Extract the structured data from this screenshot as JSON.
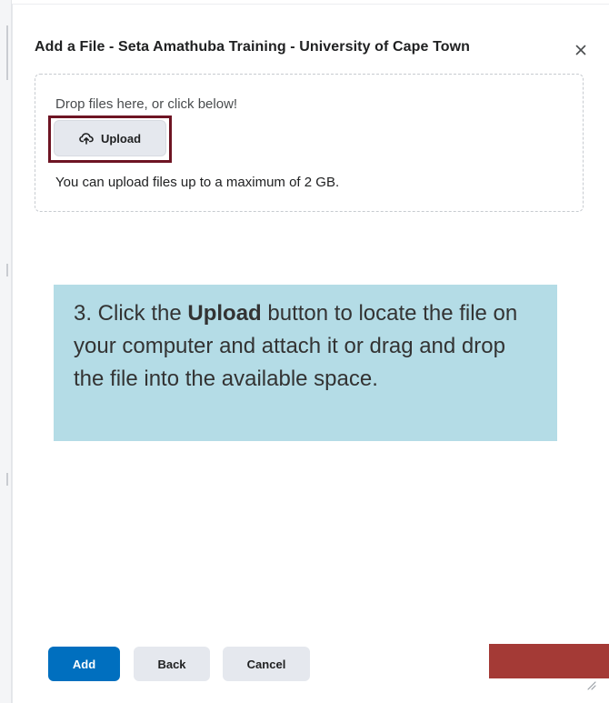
{
  "dialog": {
    "title": "Add a File - Seta Amathuba Training - University of Cape Town",
    "close_symbol": "×"
  },
  "dropzone": {
    "drop_text": "Drop files here, or click below!",
    "upload_label": "Upload",
    "upload_icon": "cloud-upload-icon",
    "limit_text": "You can upload files up to a maximum of 2 GB."
  },
  "callout": {
    "prefix": "3. Click the ",
    "bold": "Upload",
    "suffix": " button to locate the file on your computer and attach it or drag and drop the file into the available space."
  },
  "footer": {
    "add_label": "Add",
    "back_label": "Back",
    "cancel_label": "Cancel"
  },
  "colors": {
    "primary": "#006fbf",
    "highlight_border": "#6e1423",
    "callout_bg": "#b4dce6",
    "red_bar": "#a43a36"
  }
}
